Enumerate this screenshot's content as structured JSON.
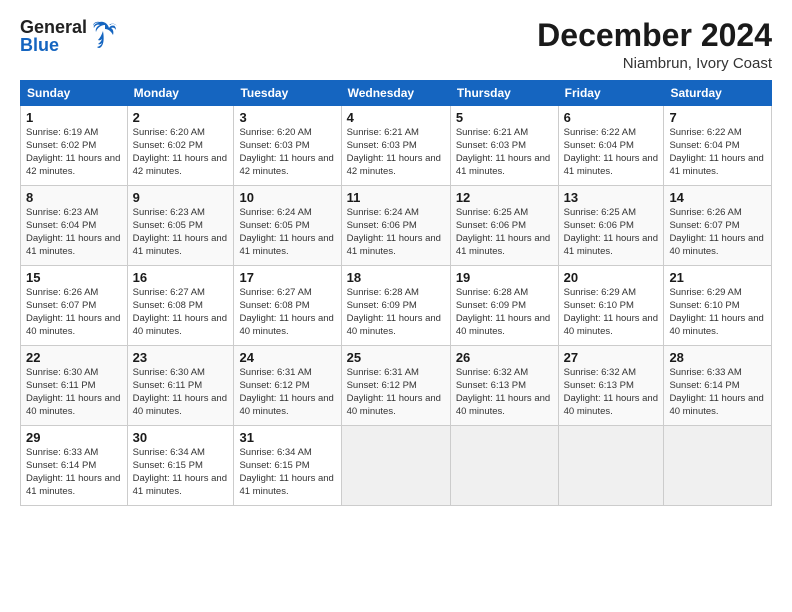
{
  "header": {
    "logo_general": "General",
    "logo_blue": "Blue",
    "title": "December 2024",
    "subtitle": "Niambrun, Ivory Coast"
  },
  "calendar": {
    "days_of_week": [
      "Sunday",
      "Monday",
      "Tuesday",
      "Wednesday",
      "Thursday",
      "Friday",
      "Saturday"
    ],
    "weeks": [
      [
        {
          "day": "",
          "empty": true
        },
        {
          "day": "",
          "empty": true
        },
        {
          "day": "",
          "empty": true
        },
        {
          "day": "",
          "empty": true
        },
        {
          "day": "",
          "empty": true
        },
        {
          "day": "",
          "empty": true
        },
        {
          "day": "",
          "empty": true
        }
      ],
      [
        {
          "day": "1",
          "sunrise": "Sunrise: 6:19 AM",
          "sunset": "Sunset: 6:02 PM",
          "daylight": "Daylight: 11 hours and 42 minutes."
        },
        {
          "day": "2",
          "sunrise": "Sunrise: 6:20 AM",
          "sunset": "Sunset: 6:02 PM",
          "daylight": "Daylight: 11 hours and 42 minutes."
        },
        {
          "day": "3",
          "sunrise": "Sunrise: 6:20 AM",
          "sunset": "Sunset: 6:03 PM",
          "daylight": "Daylight: 11 hours and 42 minutes."
        },
        {
          "day": "4",
          "sunrise": "Sunrise: 6:21 AM",
          "sunset": "Sunset: 6:03 PM",
          "daylight": "Daylight: 11 hours and 42 minutes."
        },
        {
          "day": "5",
          "sunrise": "Sunrise: 6:21 AM",
          "sunset": "Sunset: 6:03 PM",
          "daylight": "Daylight: 11 hours and 41 minutes."
        },
        {
          "day": "6",
          "sunrise": "Sunrise: 6:22 AM",
          "sunset": "Sunset: 6:04 PM",
          "daylight": "Daylight: 11 hours and 41 minutes."
        },
        {
          "day": "7",
          "sunrise": "Sunrise: 6:22 AM",
          "sunset": "Sunset: 6:04 PM",
          "daylight": "Daylight: 11 hours and 41 minutes."
        }
      ],
      [
        {
          "day": "8",
          "sunrise": "Sunrise: 6:23 AM",
          "sunset": "Sunset: 6:04 PM",
          "daylight": "Daylight: 11 hours and 41 minutes."
        },
        {
          "day": "9",
          "sunrise": "Sunrise: 6:23 AM",
          "sunset": "Sunset: 6:05 PM",
          "daylight": "Daylight: 11 hours and 41 minutes."
        },
        {
          "day": "10",
          "sunrise": "Sunrise: 6:24 AM",
          "sunset": "Sunset: 6:05 PM",
          "daylight": "Daylight: 11 hours and 41 minutes."
        },
        {
          "day": "11",
          "sunrise": "Sunrise: 6:24 AM",
          "sunset": "Sunset: 6:06 PM",
          "daylight": "Daylight: 11 hours and 41 minutes."
        },
        {
          "day": "12",
          "sunrise": "Sunrise: 6:25 AM",
          "sunset": "Sunset: 6:06 PM",
          "daylight": "Daylight: 11 hours and 41 minutes."
        },
        {
          "day": "13",
          "sunrise": "Sunrise: 6:25 AM",
          "sunset": "Sunset: 6:06 PM",
          "daylight": "Daylight: 11 hours and 41 minutes."
        },
        {
          "day": "14",
          "sunrise": "Sunrise: 6:26 AM",
          "sunset": "Sunset: 6:07 PM",
          "daylight": "Daylight: 11 hours and 40 minutes."
        }
      ],
      [
        {
          "day": "15",
          "sunrise": "Sunrise: 6:26 AM",
          "sunset": "Sunset: 6:07 PM",
          "daylight": "Daylight: 11 hours and 40 minutes."
        },
        {
          "day": "16",
          "sunrise": "Sunrise: 6:27 AM",
          "sunset": "Sunset: 6:08 PM",
          "daylight": "Daylight: 11 hours and 40 minutes."
        },
        {
          "day": "17",
          "sunrise": "Sunrise: 6:27 AM",
          "sunset": "Sunset: 6:08 PM",
          "daylight": "Daylight: 11 hours and 40 minutes."
        },
        {
          "day": "18",
          "sunrise": "Sunrise: 6:28 AM",
          "sunset": "Sunset: 6:09 PM",
          "daylight": "Daylight: 11 hours and 40 minutes."
        },
        {
          "day": "19",
          "sunrise": "Sunrise: 6:28 AM",
          "sunset": "Sunset: 6:09 PM",
          "daylight": "Daylight: 11 hours and 40 minutes."
        },
        {
          "day": "20",
          "sunrise": "Sunrise: 6:29 AM",
          "sunset": "Sunset: 6:10 PM",
          "daylight": "Daylight: 11 hours and 40 minutes."
        },
        {
          "day": "21",
          "sunrise": "Sunrise: 6:29 AM",
          "sunset": "Sunset: 6:10 PM",
          "daylight": "Daylight: 11 hours and 40 minutes."
        }
      ],
      [
        {
          "day": "22",
          "sunrise": "Sunrise: 6:30 AM",
          "sunset": "Sunset: 6:11 PM",
          "daylight": "Daylight: 11 hours and 40 minutes."
        },
        {
          "day": "23",
          "sunrise": "Sunrise: 6:30 AM",
          "sunset": "Sunset: 6:11 PM",
          "daylight": "Daylight: 11 hours and 40 minutes."
        },
        {
          "day": "24",
          "sunrise": "Sunrise: 6:31 AM",
          "sunset": "Sunset: 6:12 PM",
          "daylight": "Daylight: 11 hours and 40 minutes."
        },
        {
          "day": "25",
          "sunrise": "Sunrise: 6:31 AM",
          "sunset": "Sunset: 6:12 PM",
          "daylight": "Daylight: 11 hours and 40 minutes."
        },
        {
          "day": "26",
          "sunrise": "Sunrise: 6:32 AM",
          "sunset": "Sunset: 6:13 PM",
          "daylight": "Daylight: 11 hours and 40 minutes."
        },
        {
          "day": "27",
          "sunrise": "Sunrise: 6:32 AM",
          "sunset": "Sunset: 6:13 PM",
          "daylight": "Daylight: 11 hours and 40 minutes."
        },
        {
          "day": "28",
          "sunrise": "Sunrise: 6:33 AM",
          "sunset": "Sunset: 6:14 PM",
          "daylight": "Daylight: 11 hours and 40 minutes."
        }
      ],
      [
        {
          "day": "29",
          "sunrise": "Sunrise: 6:33 AM",
          "sunset": "Sunset: 6:14 PM",
          "daylight": "Daylight: 11 hours and 41 minutes."
        },
        {
          "day": "30",
          "sunrise": "Sunrise: 6:34 AM",
          "sunset": "Sunset: 6:15 PM",
          "daylight": "Daylight: 11 hours and 41 minutes."
        },
        {
          "day": "31",
          "sunrise": "Sunrise: 6:34 AM",
          "sunset": "Sunset: 6:15 PM",
          "daylight": "Daylight: 11 hours and 41 minutes."
        },
        {
          "day": "",
          "empty": true
        },
        {
          "day": "",
          "empty": true
        },
        {
          "day": "",
          "empty": true
        },
        {
          "day": "",
          "empty": true
        }
      ]
    ]
  }
}
